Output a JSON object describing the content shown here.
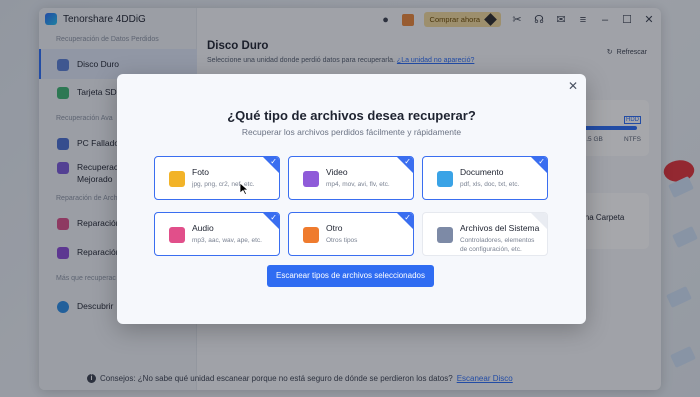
{
  "app": {
    "name": "Tenorshare 4DDiG"
  },
  "topbar": {
    "buy_label": "Comprar ahora"
  },
  "sidebar": {
    "sections": [
      {
        "label": "Recuperación de Datos Perdidos"
      },
      {
        "label": "Recuperación Ava"
      },
      {
        "label": "Reparación de Arch"
      },
      {
        "label": "Más que recuperac"
      }
    ],
    "items": [
      {
        "label": "Disco Duro"
      },
      {
        "label": "Tarjeta SD"
      },
      {
        "label": "PC Fallado"
      },
      {
        "label": "Recuperación Mejorado"
      },
      {
        "label": "Reparación"
      },
      {
        "label": "Reparación"
      },
      {
        "label": "Descubrir"
      }
    ]
  },
  "main": {
    "title": "Disco Duro",
    "subtitle": "Seleccione una unidad donde perdió datos para recuperarla.",
    "subtitle_link": "¿La unidad no apareció?",
    "refresh_label": "Refrescar",
    "drive": {
      "type": "HDD",
      "size": "31.5 GB",
      "fs": "NTFS"
    },
    "folder_label": "ar una Carpeta",
    "tips_text": "Consejos: ¿No sabe qué unidad escanear porque no está seguro de dónde se perdieron los datos?",
    "tips_link": "Escanear Disco"
  },
  "modal": {
    "title": "¿Qué tipo de archivos desea recuperar?",
    "subtitle": "Recuperar los archivos perdidos fácilmente y rápidamente",
    "cards": [
      {
        "name": "Foto",
        "desc": "jpg, png, cr2, nef, etc.",
        "selected": true,
        "color": "#f2b328"
      },
      {
        "name": "Video",
        "desc": "mp4, mov, avi, flv, etc.",
        "selected": true,
        "color": "#8f5bd9"
      },
      {
        "name": "Documento",
        "desc": "pdf, xls, doc, txt, etc.",
        "selected": true,
        "color": "#3aa3e6"
      },
      {
        "name": "Audio",
        "desc": "mp3, aac, wav, ape, etc.",
        "selected": true,
        "color": "#e14f8a"
      },
      {
        "name": "Otro",
        "desc": "Otros tipos",
        "selected": true,
        "color": "#ef7b2e"
      },
      {
        "name": "Archivos del Sistema",
        "desc": "Controladores, elementos de configuración, etc.",
        "selected": false,
        "color": "#7d8aa6"
      }
    ],
    "scan_button": "Escanear tipos de archivos seleccionados",
    "accent": "#2f6cf2"
  }
}
